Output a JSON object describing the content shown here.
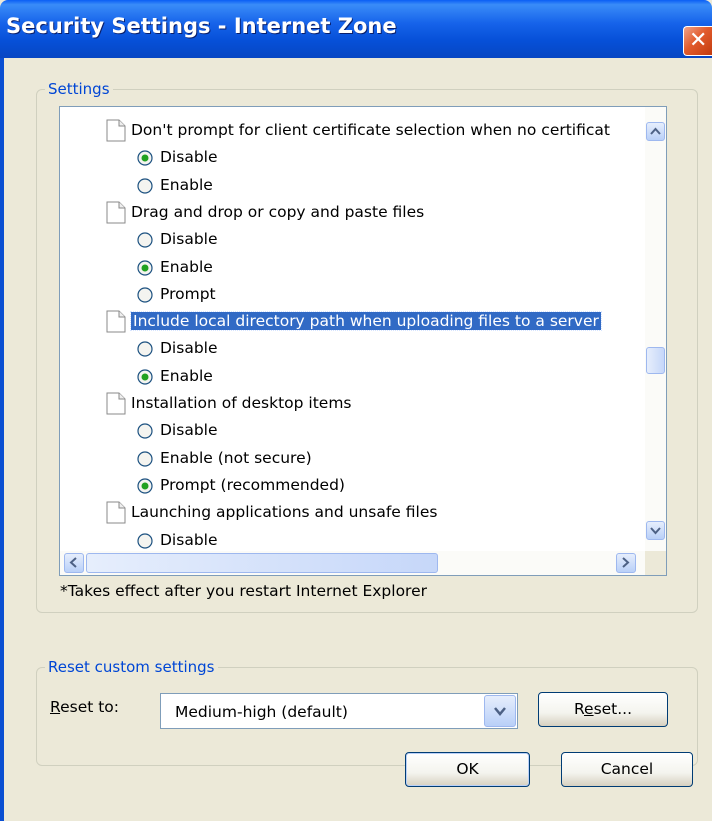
{
  "window": {
    "title": "Security Settings - Internet Zone"
  },
  "settings_group": {
    "legend": "Settings"
  },
  "settings_list": [
    {
      "type": "heading",
      "text": "Don't prompt for client certificate selection when no certificat"
    },
    {
      "type": "option",
      "text": "Disable",
      "checked": true
    },
    {
      "type": "option",
      "text": "Enable",
      "checked": false
    },
    {
      "type": "heading",
      "text": "Drag and drop or copy and paste files"
    },
    {
      "type": "option",
      "text": "Disable",
      "checked": false
    },
    {
      "type": "option",
      "text": "Enable",
      "checked": true
    },
    {
      "type": "option",
      "text": "Prompt",
      "checked": false
    },
    {
      "type": "heading",
      "text": "Include local directory path when uploading files to a server",
      "selected": true
    },
    {
      "type": "option",
      "text": "Disable",
      "checked": false
    },
    {
      "type": "option",
      "text": "Enable",
      "checked": true
    },
    {
      "type": "heading",
      "text": "Installation of desktop items"
    },
    {
      "type": "option",
      "text": "Disable",
      "checked": false
    },
    {
      "type": "option",
      "text": "Enable (not secure)",
      "checked": false
    },
    {
      "type": "option",
      "text": "Prompt (recommended)",
      "checked": true
    },
    {
      "type": "heading",
      "text": "Launching applications and unsafe files"
    },
    {
      "type": "option",
      "text": "Disable",
      "checked": false
    }
  ],
  "scroll": {
    "vertical_position": 0.5,
    "horizontal_position": 0.0
  },
  "note": "*Takes effect after you restart Internet Explorer",
  "reset_group": {
    "legend": "Reset custom settings",
    "label_accel": "R",
    "label_rest": "eset to:",
    "selected_value": "Medium-high (default)",
    "reset_button_pre": "R",
    "reset_button_accel": "e",
    "reset_button_post": "set..."
  },
  "buttons": {
    "ok": "OK",
    "cancel": "Cancel"
  },
  "colors": {
    "title_bar": "#0a5ef5",
    "selection": "#316ac5",
    "dialog_bg": "#ece9d8",
    "legend": "#0046d5"
  }
}
